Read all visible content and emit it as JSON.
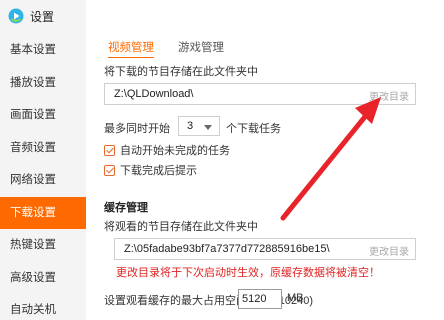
{
  "window": {
    "title": "设置",
    "logo_icon": "play-logo-icon"
  },
  "sidebar": {
    "items": [
      {
        "label": "基本设置"
      },
      {
        "label": "播放设置"
      },
      {
        "label": "画面设置"
      },
      {
        "label": "音频设置"
      },
      {
        "label": "网络设置"
      },
      {
        "label": "下载设置",
        "active": true
      },
      {
        "label": "热键设置"
      },
      {
        "label": "高级设置"
      },
      {
        "label": "自动关机"
      }
    ]
  },
  "tabs": [
    {
      "label": "视频管理",
      "active": true
    },
    {
      "label": "游戏管理"
    }
  ],
  "download": {
    "folder_label": "将下载的节目存储在此文件夹中",
    "folder_path": "Z:\\QLDownload\\",
    "change_label": "更改目录",
    "concurrent_prefix": "最多同时开始",
    "concurrent_value": "3",
    "concurrent_suffix": "个下载任务",
    "auto_start_label": "自动开始未完成的任务",
    "auto_start_checked": true,
    "notify_label": "下载完成后提示",
    "notify_checked": true
  },
  "cache": {
    "title": "缓存管理",
    "folder_label": "将观看的节目存储在此文件夹中",
    "folder_path": "Z:\\05fadabe93bf7a7377d772885916be15\\",
    "change_label": "更改目录",
    "warning": "更改目录将于下次启动时生效，原缓存数据将被清空！",
    "max_space_label": "设置观看缓存的最大占用空间(1024-10240)",
    "max_space_value": "5120",
    "unit": "MB"
  },
  "colors": {
    "accent": "#ff6a00",
    "warning": "#e02424",
    "arrow": "#e8232a"
  }
}
